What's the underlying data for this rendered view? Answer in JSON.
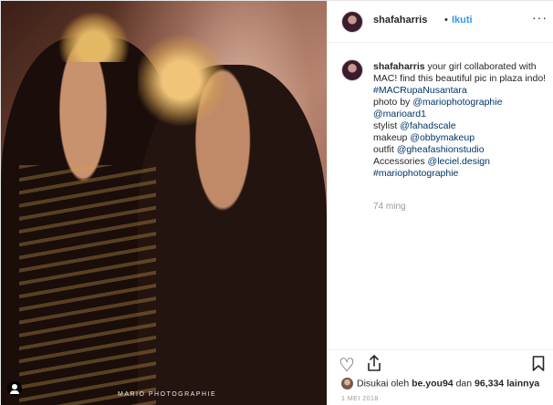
{
  "photo": {
    "watermark": "MARIO PHOTOGRAPHIE"
  },
  "header": {
    "username": "shafaharris",
    "dot": "•",
    "follow_label": "Ikuti",
    "more": "···"
  },
  "caption": {
    "username": "shafaharris",
    "intro": "your girl collaborated with MAC! find this beautiful pic in plaza indo!",
    "lines": [
      {
        "text": "#MACRupaNusantara",
        "type": "link"
      },
      {
        "text": "photo by @mariophotographie",
        "type": "mixed_photo"
      },
      {
        "text": "@marioard1",
        "type": "link"
      },
      {
        "text": "stylist @fahadscale",
        "type": "mixed_stylist"
      },
      {
        "text": "makeup @obbymakeup",
        "type": "mixed_makeup"
      },
      {
        "text": "outfit @gheafashionstudio",
        "type": "mixed_outfit"
      },
      {
        "text": "Accessories @leciel.design",
        "type": "mixed_acc"
      },
      {
        "text": "#mariophotographie",
        "type": "link"
      }
    ],
    "photo_prefix": "photo by ",
    "photo_link": "@mariophotographie",
    "stylist_prefix": "stylist ",
    "stylist_link": "@fahadscale",
    "makeup_prefix": "makeup ",
    "makeup_link": "@obbymakeup",
    "outfit_prefix": "outfit ",
    "outfit_link": "@gheafashionstudio",
    "acc_prefix": "Accessories ",
    "acc_link": "@leciel.design",
    "hashtag1": "#MACRupaNusantara",
    "mention1": "@marioard1",
    "hashtag2": "#mariophotographie",
    "time_ago": "74 ming"
  },
  "likes": {
    "prefix": "Disukai oleh",
    "user": "be.you94",
    "joiner": "dan",
    "count": "96,334",
    "suffix": "lainnya"
  },
  "date": "1 MEI 2018",
  "colors": {
    "link": "#003569",
    "follow": "#3897f0",
    "muted": "#999999"
  },
  "icons": [
    "heart-icon",
    "share-icon",
    "bookmark-icon",
    "more-icon",
    "user-tag-icon"
  ]
}
